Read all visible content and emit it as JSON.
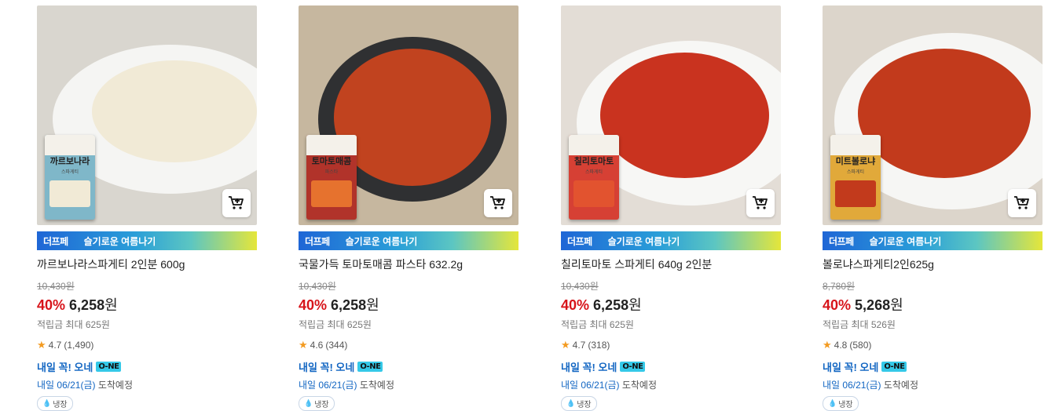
{
  "products": [
    {
      "title": "까르보나라스파게티 2인분 600g",
      "package_label": "까르보나라",
      "package_sub": "스파게티",
      "banner_brand": "더프페",
      "banner_event": "슬기로운 여름나기",
      "original_price": "10,430원",
      "discount": "40%",
      "price": "6,258",
      "price_unit": "원",
      "points": "적립금 최대 625원",
      "rating": "4.7",
      "reviews": "(1,490)",
      "delivery": "내일 꼭! 오네",
      "delivery_badge": "O-NE",
      "arrival_date": "내일 06/21(금)",
      "arrival_suffix": "도착예정",
      "storage": "냉장",
      "colors": {
        "bg": "#d9d6cf",
        "sauce": "#f1ead6",
        "accent": "#c9a97a",
        "package": "#7fb7c9"
      }
    },
    {
      "title": "국물가득 토마토매콤 파스타 632.2g",
      "package_label": "토마토매콤",
      "package_sub": "파스타",
      "banner_brand": "더프페",
      "banner_event": "슬기로운 여름나기",
      "original_price": "10,430원",
      "discount": "40%",
      "price": "6,258",
      "price_unit": "원",
      "points": "적립금 최대 625원",
      "rating": "4.6",
      "reviews": "(344)",
      "delivery": "내일 꼭! 오네",
      "delivery_badge": "O-NE",
      "arrival_date": "내일 06/21(금)",
      "arrival_suffix": "도착예정",
      "storage": "냉장",
      "colors": {
        "bg": "#c6b79f",
        "sauce": "#c1431f",
        "accent": "#e6722e",
        "package": "#b1332a"
      }
    },
    {
      "title": "칠리토마토 스파게티 640g 2인분",
      "package_label": "칠리토마토",
      "package_sub": "스파게티",
      "banner_brand": "더프페",
      "banner_event": "슬기로운 여름나기",
      "original_price": "10,430원",
      "discount": "40%",
      "price": "6,258",
      "price_unit": "원",
      "points": "적립금 최대 625원",
      "rating": "4.7",
      "reviews": "(318)",
      "delivery": "내일 꼭! 오네",
      "delivery_badge": "O-NE",
      "arrival_date": "내일 06/21(금)",
      "arrival_suffix": "도착예정",
      "storage": "냉장",
      "colors": {
        "bg": "#e3ddd6",
        "sauce": "#c9331f",
        "accent": "#e2532f",
        "package": "#d64034"
      }
    },
    {
      "title": "볼로냐스파게티2인625g",
      "package_label": "미트볼로냐",
      "package_sub": "스파게티",
      "banner_brand": "더프페",
      "banner_event": "슬기로운 여름나기",
      "original_price": "8,780원",
      "discount": "40%",
      "price": "5,268",
      "price_unit": "원",
      "points": "적립금 최대 526원",
      "rating": "4.8",
      "reviews": "(580)",
      "delivery": "내일 꼭! 오네",
      "delivery_badge": "O-NE",
      "arrival_date": "내일 06/21(금)",
      "arrival_suffix": "도착예정",
      "storage": "냉장",
      "colors": {
        "bg": "#dcd5cb",
        "sauce": "#c23a1c",
        "accent": "#d8622a",
        "package": "#e1a93a"
      }
    }
  ]
}
